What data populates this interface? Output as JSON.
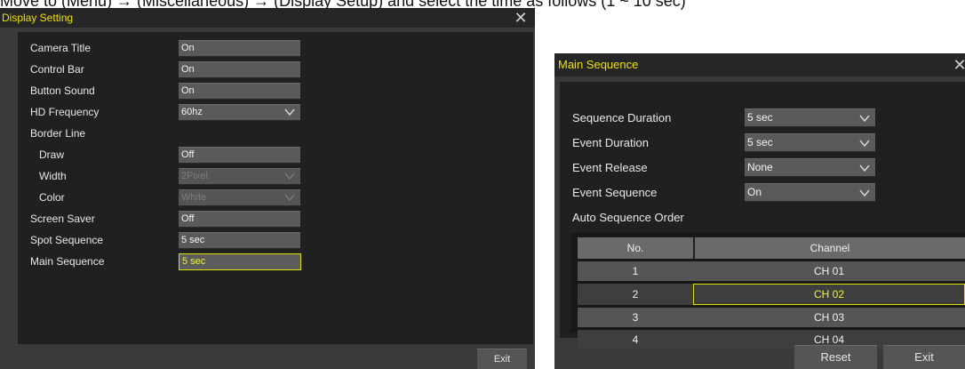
{
  "caption": "Move to (Menu) → (Miscellaneous) → (Display Setup) and select the time as follows (1 ~ 10 sec)",
  "display_setting": {
    "title": "Display Setting",
    "close_glyph": "✕",
    "rows": [
      {
        "label": "Camera Title",
        "value": "On"
      },
      {
        "label": "Control Bar",
        "value": "On"
      },
      {
        "label": "Button Sound",
        "value": "On"
      },
      {
        "label": "HD Frequency",
        "value": "60hz",
        "dropdown": true
      },
      {
        "label": "Border Line"
      },
      {
        "label": "Draw",
        "value": "Off"
      },
      {
        "label": "Width",
        "value": "2Pixel",
        "dropdown": true,
        "disabled": true
      },
      {
        "label": "Color",
        "value": "White",
        "dropdown": true,
        "disabled": true
      },
      {
        "label": "Screen Saver",
        "value": "Off"
      },
      {
        "label": "Spot Sequence",
        "value": "5 sec"
      },
      {
        "label": "Main Sequence",
        "value": "5 sec",
        "focused": true
      }
    ],
    "exit_label": "Exit"
  },
  "main_sequence": {
    "title": "Main Sequence",
    "close_glyph": "✕",
    "rows": [
      {
        "label": "Sequence Duration",
        "value": "5 sec"
      },
      {
        "label": "Event Duration",
        "value": "5 sec"
      },
      {
        "label": "Event Release",
        "value": "None"
      },
      {
        "label": "Event Sequence",
        "value": "On"
      }
    ],
    "order_label": "Auto Sequence Order",
    "table": {
      "headers": [
        "No.",
        "Channel"
      ],
      "rows": [
        {
          "no": "1",
          "channel": "CH 01"
        },
        {
          "no": "2",
          "channel": "CH 02"
        },
        {
          "no": "3",
          "channel": "CH 03"
        },
        {
          "no": "4",
          "channel": "CH 04"
        }
      ]
    },
    "reset_label": "Reset",
    "exit_label": "Exit"
  },
  "colors": {
    "title_text": "#f0e000",
    "focus_border": "#e0e000",
    "panel_bg": "#202020",
    "field_bg": "#5a5a5a"
  }
}
